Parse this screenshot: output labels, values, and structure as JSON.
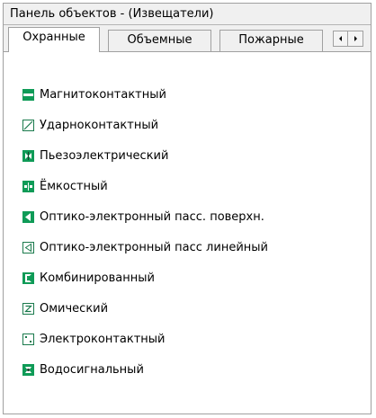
{
  "window": {
    "title": "Панель объектов - (Извещатели)"
  },
  "tabs": [
    {
      "label": "Охранные",
      "active": true
    },
    {
      "label": "Объемные",
      "active": false
    },
    {
      "label": "Пожарные",
      "active": false
    }
  ],
  "tab_scroll": {
    "left_icon": "arrow-left",
    "right_icon": "arrow-right"
  },
  "items": [
    {
      "label": "Магнитоконтактный",
      "icon": "magnetic-contact-icon"
    },
    {
      "label": "Ударноконтактный",
      "icon": "shock-contact-icon"
    },
    {
      "label": "Пьезоэлектрический",
      "icon": "piezoelectric-icon"
    },
    {
      "label": "Ёмкостный",
      "icon": "capacitive-icon"
    },
    {
      "label": "Оптико-электронный пасс. поверхн.",
      "icon": "optical-passive-surface-icon"
    },
    {
      "label": "Оптико-электронный пасс линейный",
      "icon": "optical-passive-linear-icon"
    },
    {
      "label": "Комбинированный",
      "icon": "combined-icon"
    },
    {
      "label": "Омический",
      "icon": "ohmic-icon"
    },
    {
      "label": "Электроконтактный",
      "icon": "electrocontact-icon"
    },
    {
      "label": "Водосигнальный",
      "icon": "water-signal-icon"
    }
  ],
  "colors": {
    "icon_green": "#0f9b57",
    "icon_dark": "#1a3d2b"
  }
}
